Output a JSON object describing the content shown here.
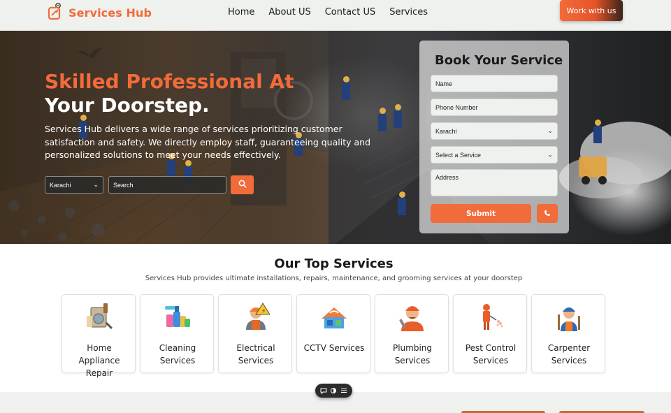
{
  "brand": {
    "name": "Services Hub",
    "accent": "#f26b3a"
  },
  "nav": {
    "links": [
      "Home",
      "About US",
      "Contact US",
      "Services"
    ],
    "cta": "Work with us"
  },
  "hero": {
    "title_line1": "Skilled Professional At",
    "title_line2": "Your Doorstep.",
    "description": "Services Hub delivers a wide range of services prioritizing customer satisfaction and safety. We directly employ staff, guaranteeing quality and personalized solutions to meet your needs effectively.",
    "city_select": "Karachi",
    "search_placeholder": "Search"
  },
  "booking": {
    "title": "Book Your Service",
    "name_placeholder": "Name",
    "phone_placeholder": "Phone Number",
    "city_value": "Karachi",
    "service_value": "Select a Service",
    "address_placeholder": "Address",
    "submit_label": "Submit"
  },
  "services": {
    "title": "Our Top Services",
    "subtitle": "Services Hub provides ultimate installations, repairs, maintenance, and grooming services at your doorstep",
    "items": [
      {
        "line1": "Home Appliance",
        "line2": "Repair",
        "icon": "appliance-repair-icon"
      },
      {
        "line1": "Cleaning",
        "line2": "Services",
        "icon": "cleaning-icon"
      },
      {
        "line1": "Electrical",
        "line2": "Services",
        "icon": "electrician-icon"
      },
      {
        "line1": "CCTV Services",
        "line2": "",
        "icon": "cctv-icon"
      },
      {
        "line1": "Plumbing",
        "line2": "Services",
        "icon": "plumber-icon"
      },
      {
        "line1": "Pest Control",
        "line2": "Services",
        "icon": "pest-control-icon"
      },
      {
        "line1": "Carpenter",
        "line2": "Services",
        "icon": "carpenter-icon"
      }
    ]
  }
}
